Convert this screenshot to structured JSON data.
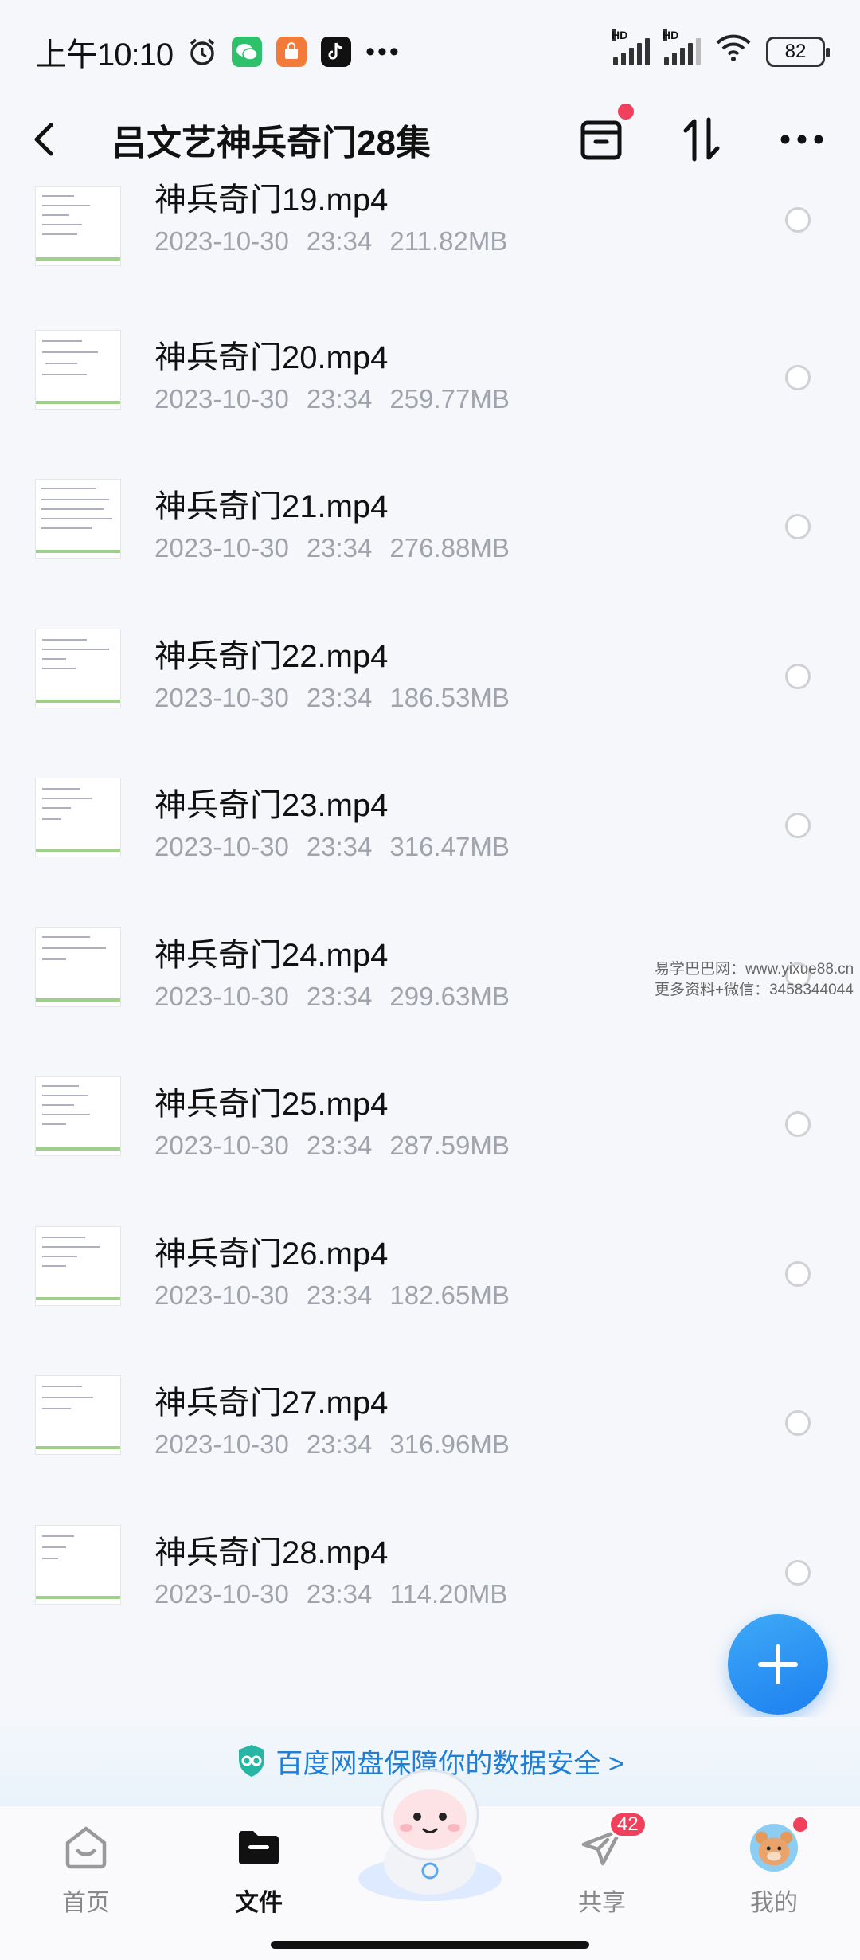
{
  "status_bar": {
    "time": "上午10:10",
    "battery": "82",
    "network_label": "HD"
  },
  "header": {
    "title": "吕文艺神兵奇门28集"
  },
  "files": [
    {
      "name": "神兵奇门19.mp4",
      "date": "2023-10-30",
      "time": "23:34",
      "size": "211.82MB"
    },
    {
      "name": "神兵奇门20.mp4",
      "date": "2023-10-30",
      "time": "23:34",
      "size": "259.77MB"
    },
    {
      "name": "神兵奇门21.mp4",
      "date": "2023-10-30",
      "time": "23:34",
      "size": "276.88MB"
    },
    {
      "name": "神兵奇门22.mp4",
      "date": "2023-10-30",
      "time": "23:34",
      "size": "186.53MB"
    },
    {
      "name": "神兵奇门23.mp4",
      "date": "2023-10-30",
      "time": "23:34",
      "size": "316.47MB"
    },
    {
      "name": "神兵奇门24.mp4",
      "date": "2023-10-30",
      "time": "23:34",
      "size": "299.63MB"
    },
    {
      "name": "神兵奇门25.mp4",
      "date": "2023-10-30",
      "time": "23:34",
      "size": "287.59MB"
    },
    {
      "name": "神兵奇门26.mp4",
      "date": "2023-10-30",
      "time": "23:34",
      "size": "182.65MB"
    },
    {
      "name": "神兵奇门27.mp4",
      "date": "2023-10-30",
      "time": "23:34",
      "size": "316.96MB"
    },
    {
      "name": "神兵奇门28.mp4",
      "date": "2023-10-30",
      "time": "23:34",
      "size": "114.20MB"
    }
  ],
  "watermark": {
    "line1": "易学巴巴网：www.yixue88.cn",
    "line2": "更多资料+微信：3458344044"
  },
  "banner": {
    "text": "百度网盘保障你的数据安全 >"
  },
  "nav": {
    "home": "首页",
    "files": "文件",
    "share": "共享",
    "share_badge": "42",
    "mine": "我的"
  },
  "colors": {
    "accent": "#1d7ff0",
    "badge": "#f0405c",
    "meta_text": "#a0a3ab"
  }
}
